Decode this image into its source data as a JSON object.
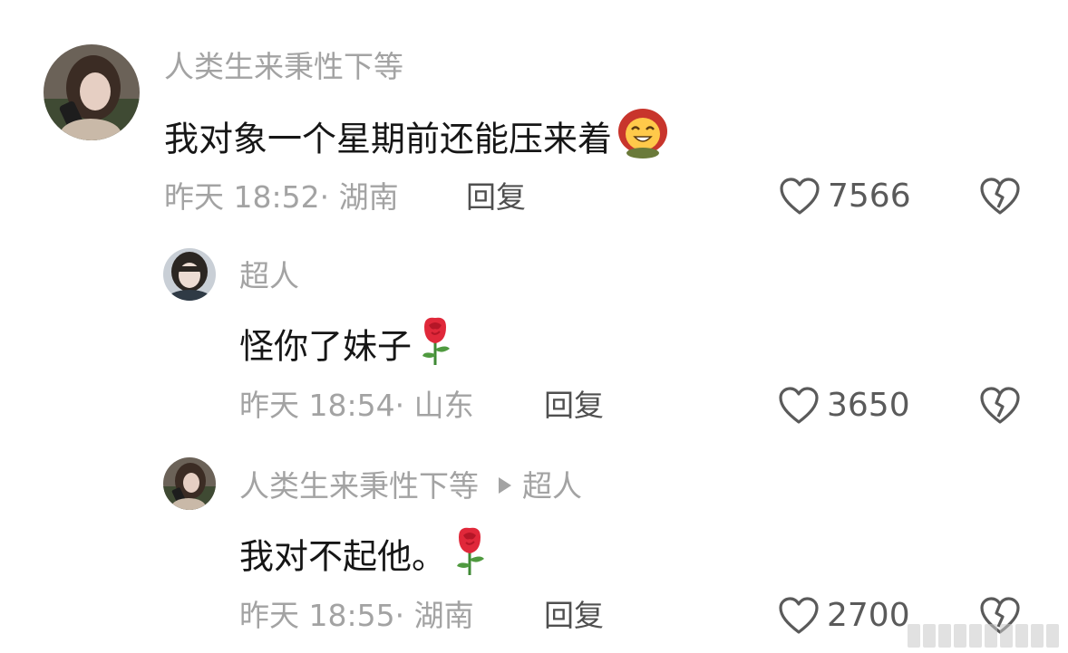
{
  "comments": [
    {
      "username": "人类生来秉性下等",
      "content": "我对象一个星期前还能压来着",
      "time_location": "昨天 18:52· 湖南",
      "reply_label": "回复",
      "likes": "7566",
      "emoji": "grin-hood-emoji"
    },
    {
      "username": "超人",
      "content": "怪你了妹子",
      "time_location": "昨天 18:54· 山东",
      "reply_label": "回复",
      "likes": "3650",
      "emoji": "rose-emoji"
    },
    {
      "username": "人类生来秉性下等",
      "reply_to": "超人",
      "content": "我对不起他。",
      "time_location": "昨天 18:55· 湖南",
      "reply_label": "回复",
      "likes": "2700",
      "emoji": "rose-emoji"
    }
  ],
  "colors": {
    "text_primary": "#161616",
    "text_secondary": "#a3a3a3",
    "reply": "#4f4f4f",
    "icon": "#5a5a5a"
  }
}
